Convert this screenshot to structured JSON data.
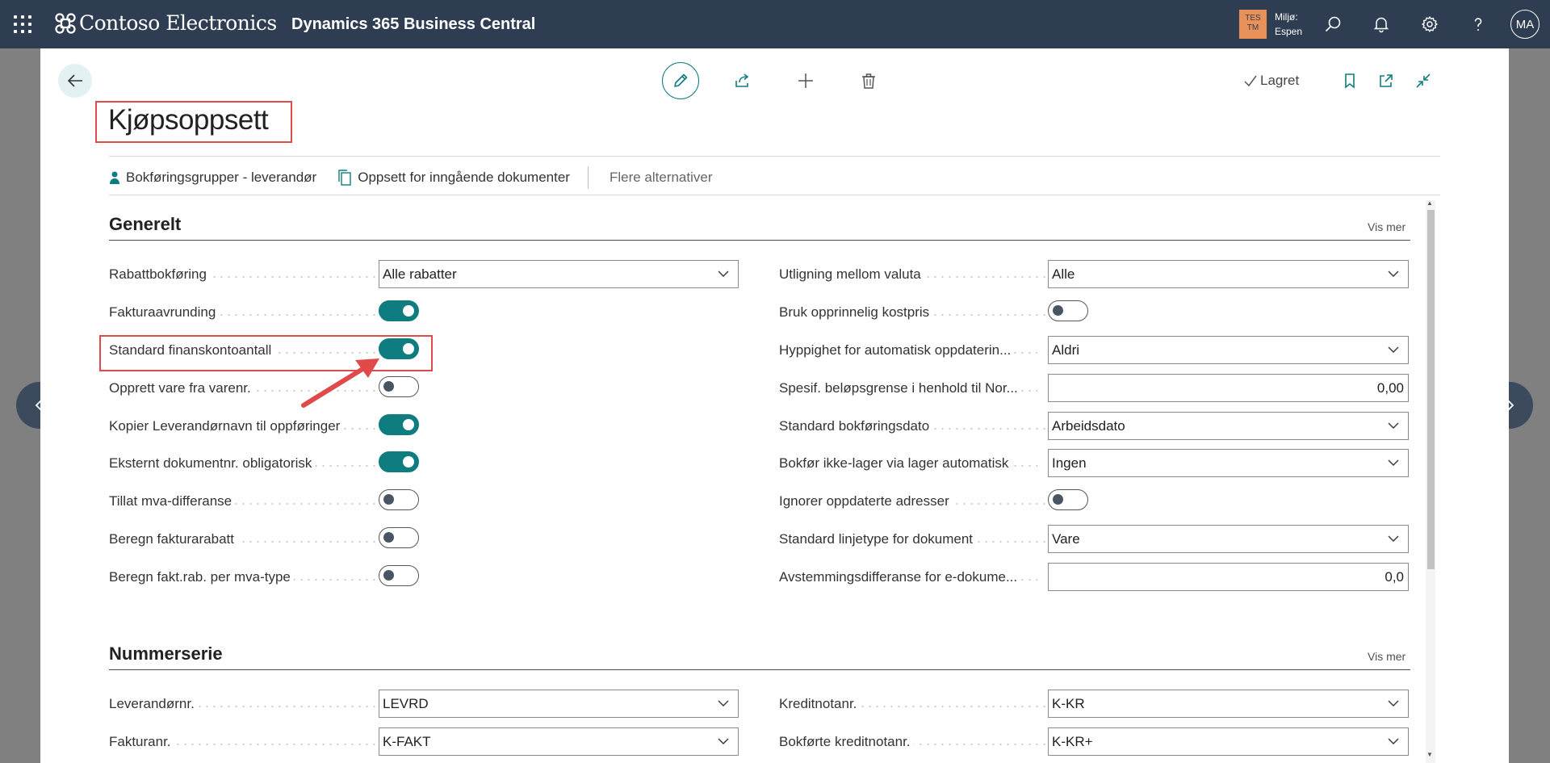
{
  "topbar": {
    "brand": "Contoso Electronics",
    "product": "Dynamics 365 Business Central",
    "env_badge_line1": "TES",
    "env_badge_line2": "TM",
    "env_label": "Miljø:",
    "env_name": "Espen",
    "avatar_initials": "MA",
    "icons": [
      "app-launcher-icon",
      "search-icon",
      "bell-icon",
      "gear-icon",
      "help-icon"
    ],
    "bar_color": "#2e3d52"
  },
  "page": {
    "title": "Kjøpsoppsett",
    "saved_label": "Lagret",
    "actions": [
      {
        "label": "Bokføringsgrupper - leverandør",
        "icon": "person-icon"
      },
      {
        "label": "Oppsett for inngående dokumenter",
        "icon": "document-copy-icon"
      },
      {
        "label": "Flere alternativer"
      }
    ],
    "accent": "#0f7d80",
    "highlight_color": "#e14a4a"
  },
  "sections": {
    "generelt": {
      "title": "Generelt",
      "more": "Vis mer",
      "left": [
        {
          "label": "Rabattbokføring",
          "type": "select",
          "value": "Alle rabatter"
        },
        {
          "label": "Fakturaavrunding",
          "type": "toggle",
          "value": true
        },
        {
          "label": "Standard finanskontoantall",
          "type": "toggle",
          "value": true
        },
        {
          "label": "Opprett vare fra varenr.",
          "type": "toggle",
          "value": false
        },
        {
          "label": "Kopier Leverandørnavn til oppføringer",
          "type": "toggle",
          "value": true
        },
        {
          "label": "Eksternt dokumentnr. obligatorisk",
          "type": "toggle",
          "value": true
        },
        {
          "label": "Tillat mva-differanse",
          "type": "toggle",
          "value": false
        },
        {
          "label": "Beregn fakturarabatt",
          "type": "toggle",
          "value": false
        },
        {
          "label": "Beregn fakt.rab. per mva-type",
          "type": "toggle",
          "value": false
        }
      ],
      "right": [
        {
          "label": "Utligning mellom valuta",
          "type": "select",
          "value": "Alle"
        },
        {
          "label": "Bruk opprinnelig kostpris",
          "type": "toggle",
          "value": false
        },
        {
          "label": "Hyppighet for automatisk oppdaterin...",
          "type": "select",
          "value": "Aldri"
        },
        {
          "label": "Spesif. beløpsgrense i henhold til Nor...",
          "type": "text",
          "value": "0,00"
        },
        {
          "label": "Standard bokføringsdato",
          "type": "select",
          "value": "Arbeidsdato"
        },
        {
          "label": "Bokfør ikke-lager via lager automatisk",
          "type": "select",
          "value": "Ingen"
        },
        {
          "label": "Ignorer oppdaterte adresser",
          "type": "toggle",
          "value": false
        },
        {
          "label": "Standard linjetype for dokument",
          "type": "select",
          "value": "Vare"
        },
        {
          "label": "Avstemmingsdifferanse for e-dokume...",
          "type": "text",
          "value": "0,0"
        }
      ]
    },
    "nummerserie": {
      "title": "Nummerserie",
      "more": "Vis mer",
      "left": [
        {
          "label": "Leverandørnr.",
          "type": "select",
          "value": "LEVRD"
        },
        {
          "label": "Fakturanr.",
          "type": "select",
          "value": "K-FAKT"
        }
      ],
      "right": [
        {
          "label": "Kreditnotanr.",
          "type": "select",
          "value": "K-KR"
        },
        {
          "label": "Bokførte kreditnotanr.",
          "type": "select",
          "value": "K-KR+"
        }
      ]
    }
  }
}
